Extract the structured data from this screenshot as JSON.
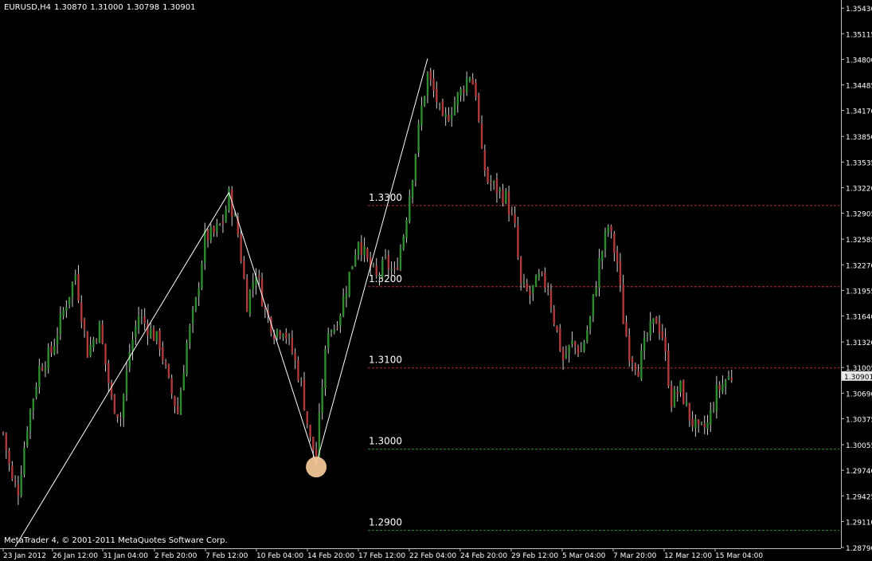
{
  "header": {
    "symbol_timeframe": "EURUSD,H4",
    "open": "1.30870",
    "high": "1.31000",
    "low": "1.30798",
    "close": "1.30901"
  },
  "copyright": "MetaTrader 4, © 2001-2011 MetaQuotes Software Corp.",
  "colors": {
    "background": "#000000",
    "bull_candle": "#2e8b2e",
    "bear_candle": "#b03a3a",
    "wick": "#cfcfcf",
    "axis": "#c0c0c0",
    "zigzag": "#ffffff",
    "level_red": "#b03030",
    "level_green": "#2a8a2a",
    "highlight": "#f6c99a",
    "price_tag_bg": "#e8e8e8"
  },
  "current_price_tag": "1.30901",
  "chart_data": {
    "type": "candlestick",
    "symbol": "EURUSD",
    "timeframe": "H4",
    "ylim": [
      1.2878,
      1.3553
    ],
    "y_ticks": [
      "1.35430",
      "1.35115",
      "1.34800",
      "1.34485",
      "1.34170",
      "1.33850",
      "1.33535",
      "1.33220",
      "1.32905",
      "1.32585",
      "1.32270",
      "1.31955",
      "1.31640",
      "1.31320",
      "1.31005",
      "1.30690",
      "1.30375",
      "1.30055",
      "1.29740",
      "1.29425",
      "1.29110",
      "1.28790"
    ],
    "x_ticks": [
      "23 Jan 2012",
      "26 Jan 12:00",
      "31 Jan 04:00",
      "2 Feb 20:00",
      "7 Feb 12:00",
      "10 Feb 04:00",
      "14 Feb 20:00",
      "17 Feb 12:00",
      "22 Feb 04:00",
      "24 Feb 20:00",
      "29 Feb 12:00",
      "5 Mar 04:00",
      "7 Mar 20:00",
      "12 Mar 12:00",
      "15 Mar 04:00"
    ],
    "levels": [
      {
        "label": "1.3300",
        "value": 1.33,
        "color": "red"
      },
      {
        "label": "1.3200",
        "value": 1.32,
        "color": "red"
      },
      {
        "label": "1.3100",
        "value": 1.31,
        "color": "red"
      },
      {
        "label": "1.3000",
        "value": 1.3,
        "color": "green"
      },
      {
        "label": "1.2900",
        "value": 1.29,
        "color": "green"
      }
    ],
    "zigzag": [
      {
        "bar": 4,
        "price": 1.288
      },
      {
        "bar": 75,
        "price": 1.3316
      },
      {
        "bar": 104,
        "price": 1.2982
      },
      {
        "bar": 141,
        "price": 1.3481
      }
    ],
    "highlight": {
      "bar": 104,
      "price": 1.2978
    },
    "anchors": [
      [
        0,
        1.302
      ],
      [
        3,
        1.296
      ],
      [
        5,
        1.295
      ],
      [
        8,
        1.303
      ],
      [
        12,
        1.31
      ],
      [
        16,
        1.312
      ],
      [
        20,
        1.317
      ],
      [
        24,
        1.3215
      ],
      [
        28,
        1.312
      ],
      [
        32,
        1.315
      ],
      [
        36,
        1.306
      ],
      [
        39,
        1.304
      ],
      [
        42,
        1.312
      ],
      [
        45,
        1.3165
      ],
      [
        48,
        1.315
      ],
      [
        52,
        1.313
      ],
      [
        55,
        1.308
      ],
      [
        58,
        1.3045
      ],
      [
        61,
        1.313
      ],
      [
        64,
        1.318
      ],
      [
        67,
        1.326
      ],
      [
        70,
        1.3265
      ],
      [
        73,
        1.328
      ],
      [
        75,
        1.3312
      ],
      [
        78,
        1.3265
      ],
      [
        81,
        1.318
      ],
      [
        84,
        1.322
      ],
      [
        87,
        1.317
      ],
      [
        90,
        1.3145
      ],
      [
        93,
        1.315
      ],
      [
        96,
        1.312
      ],
      [
        99,
        1.308
      ],
      [
        102,
        1.301
      ],
      [
        104,
        1.299
      ],
      [
        106,
        1.308
      ],
      [
        108,
        1.315
      ],
      [
        110,
        1.315
      ],
      [
        112,
        1.317
      ],
      [
        115,
        1.3215
      ],
      [
        118,
        1.326
      ],
      [
        121,
        1.323
      ],
      [
        124,
        1.321
      ],
      [
        127,
        1.323
      ],
      [
        130,
        1.3215
      ],
      [
        133,
        1.3265
      ],
      [
        136,
        1.334
      ],
      [
        139,
        1.342
      ],
      [
        141,
        1.346
      ],
      [
        144,
        1.343
      ],
      [
        146,
        1.34
      ],
      [
        149,
        1.342
      ],
      [
        152,
        1.344
      ],
      [
        155,
        1.3462
      ],
      [
        157,
        1.344
      ],
      [
        159,
        1.336
      ],
      [
        161,
        1.333
      ],
      [
        164,
        1.332
      ],
      [
        167,
        1.331
      ],
      [
        170,
        1.327
      ],
      [
        172,
        1.32
      ],
      [
        175,
        1.319
      ],
      [
        178,
        1.321
      ],
      [
        181,
        1.32
      ],
      [
        183,
        1.316
      ],
      [
        186,
        1.311
      ],
      [
        189,
        1.313
      ],
      [
        192,
        1.312
      ],
      [
        195,
        1.316
      ],
      [
        198,
        1.323
      ],
      [
        201,
        1.3275
      ],
      [
        204,
        1.323
      ],
      [
        206,
        1.316
      ],
      [
        208,
        1.312
      ],
      [
        211,
        1.31
      ],
      [
        214,
        1.314
      ],
      [
        217,
        1.316
      ],
      [
        219,
        1.314
      ],
      [
        222,
        1.306
      ],
      [
        225,
        1.3075
      ],
      [
        228,
        1.304
      ],
      [
        231,
        1.302
      ],
      [
        234,
        1.303
      ],
      [
        237,
        1.307
      ],
      [
        240,
        1.3085
      ],
      [
        242,
        1.309
      ]
    ]
  }
}
